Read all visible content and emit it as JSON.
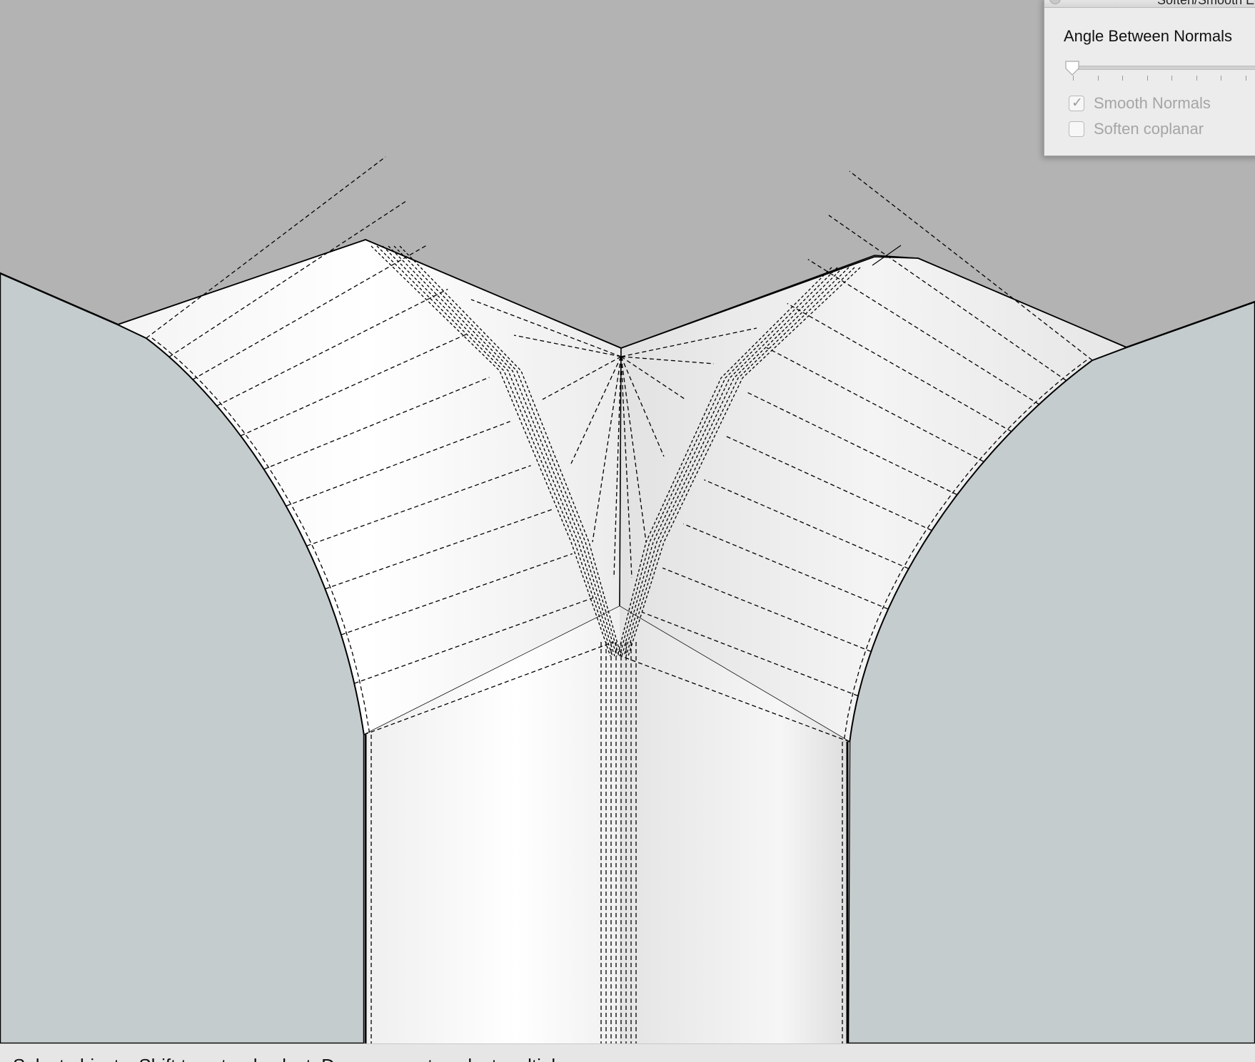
{
  "dialog": {
    "title": "Soften/Smooth Edges",
    "angle_label": "Angle Between Normals",
    "angle_value_fraction": 0,
    "smooth_normals": {
      "label": "Smooth Normals",
      "checked": true,
      "enabled": false
    },
    "soften_coplanar": {
      "label": "Soften coplanar",
      "checked": false,
      "enabled": false
    }
  },
  "status_bar": {
    "text": "Select objects. Shift to extend select. Drag mouse to select multiple."
  },
  "colors": {
    "background_sky": "#b3b3b3",
    "ground": "#c5ccce",
    "surface": "#f2f2f2",
    "edge": "#000000"
  }
}
